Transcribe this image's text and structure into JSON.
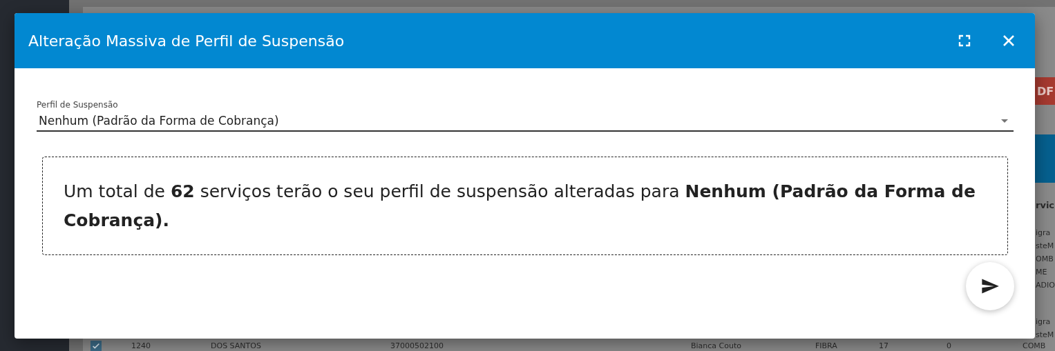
{
  "background": {
    "export_button": "DF",
    "column_heading": "rvic",
    "column_cells": [
      "igra",
      "steM",
      "OMB",
      "ME",
      "ADIO",
      "igra",
      "steM"
    ],
    "row": {
      "checked": true,
      "cells": [
        "1240",
        "DOS SANTOS",
        "37000502100",
        "Bianca Couto",
        "FIBRA",
        "17",
        "0",
        "COMB"
      ]
    }
  },
  "dialog": {
    "title": "Alteração Massiva de Perfil de Suspensão",
    "field": {
      "label": "Perfil de Suspensão",
      "value": "Nenhum (Padrão da Forma de Cobrança)"
    },
    "message": "Um total de **62** serviços terão o seu perfil de suspensão alteradas para **Nenhum (Padrão da Forma de Cobrança).**"
  }
}
